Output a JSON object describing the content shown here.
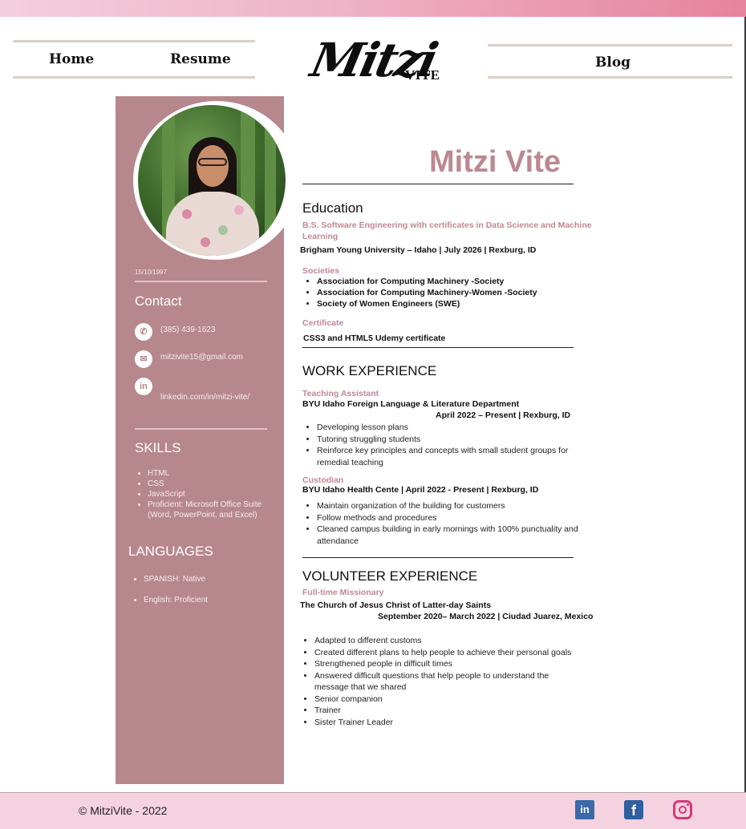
{
  "nav": {
    "home": "Home",
    "resume": "Resume",
    "blog": "Blog"
  },
  "logo": {
    "main": "Mitzi",
    "sub": "VITE"
  },
  "profile": {
    "name": "Mitzi Vite",
    "dob": "15/10/1997"
  },
  "contact": {
    "heading": "Contact",
    "phone": "(385) 439-1623",
    "email": "mitzivite15@gmail.com",
    "linkedin": "linkedin.com/in/mitzi-vite/",
    "icons": [
      "phone-icon",
      "mail-icon",
      "linkedin-icon"
    ]
  },
  "skills": {
    "heading": "SKILLS",
    "items": [
      "HTML",
      "CSS",
      "JavaScript",
      "Proficient: Microsoft Office Suite (Word, PowerPoint, and Excel)"
    ]
  },
  "languages": {
    "heading": "LANGUAGES",
    "items": [
      "SPANISH: Native",
      "English: Proficient"
    ]
  },
  "education": {
    "heading": "Education",
    "degree": "B.S. Software Engineering with certificates in Data Science and Machine Learning",
    "school": "Brigham Young University – Idaho | July 2026 | Rexburg, ID",
    "societies_label": "Societies",
    "societies": [
      "Association for Computing Machinery -Society",
      "Association for Computing Machinery-Women -Society",
      "Society of Women Engineers (SWE)"
    ],
    "certificate_label": "Certificate",
    "certificate": "CSS3 and HTML5 Udemy certificate"
  },
  "work": {
    "heading": "WORK EXPERIENCE",
    "jobs": [
      {
        "title": "Teaching Assistant",
        "org": "BYU Idaho Foreign Language & Literature Department",
        "dates": "April 2022 – Present | Rexburg, ID",
        "bullets": [
          "Developing lesson plans",
          "Tutoring struggling students",
          "Reinforce key principles and concepts with small student groups for remedial teaching"
        ]
      },
      {
        "title": "Custodian",
        "org": "BYU Idaho Health Cente | April 2022 - Present | Rexburg, ID",
        "bullets": [
          "Maintain organization of the building for customers",
          "Follow methods and procedures",
          "Cleaned campus building in early mornings with 100% punctuality and attendance"
        ]
      }
    ]
  },
  "volunteer": {
    "heading": "VOLUNTEER EXPERIENCE",
    "title": "Full-time Missionary",
    "org": "The Church of Jesus Christ of Latter-day Saints",
    "dates": "September 2020– March 2022 | Ciudad Juarez, Mexico",
    "bullets": [
      "Adapted to different customs",
      "Created different plans to help people to achieve their personal goals",
      "Strengthened people in difficult times",
      "Answered difficult questions that help people to understand the message that we shared",
      "Senior companion",
      "Trainer",
      "Sister Trainer Leader"
    ]
  },
  "footer": {
    "copyright": "© MitziVite - 2022",
    "social": [
      "linkedin-icon",
      "facebook-icon",
      "instagram-icon"
    ],
    "linkedin_glyph": "in",
    "facebook_glyph": "f"
  },
  "colors": {
    "accent": "#b7878e",
    "name": "#bb8890",
    "footer": "#f5d2df",
    "topbar_end": "#e6839f"
  }
}
